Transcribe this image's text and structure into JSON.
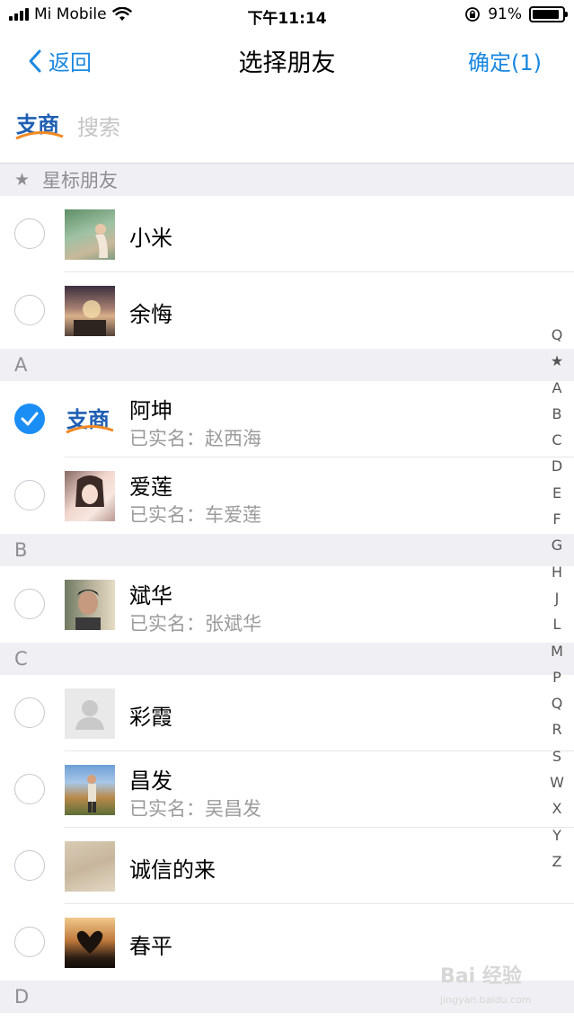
{
  "status_bar": {
    "carrier": "Mi Mobile",
    "time": "下午11:14",
    "battery_text": "91%",
    "battery_level": 0.91
  },
  "nav": {
    "back_label": "返回",
    "title": "选择朋友",
    "confirm_label": "确定(1)"
  },
  "search": {
    "placeholder": "搜索",
    "logo_text": "支商"
  },
  "sections": {
    "starred": {
      "label": "星标朋友",
      "items": [
        {
          "name": "小米"
        },
        {
          "name": "余悔"
        }
      ]
    },
    "a": {
      "label": "A",
      "items": [
        {
          "name": "阿坤",
          "realname": "已实名：赵西海"
        },
        {
          "name": "爱莲",
          "realname": "已实名：车爱莲"
        }
      ]
    },
    "b": {
      "label": "B",
      "items": [
        {
          "name": "斌华",
          "realname": "已实名：张斌华"
        }
      ]
    },
    "c": {
      "label": "C",
      "items": [
        {
          "name": "彩霞"
        },
        {
          "name": "昌发",
          "realname": "已实名：吴昌发"
        },
        {
          "name": "诚信的来"
        },
        {
          "name": "春平"
        }
      ]
    },
    "d": {
      "label": "D"
    }
  },
  "index": [
    "Q",
    "★",
    "A",
    "B",
    "C",
    "D",
    "E",
    "F",
    "G",
    "H",
    "J",
    "L",
    "M",
    "P",
    "Q",
    "R",
    "S",
    "W",
    "X",
    "Y",
    "Z"
  ],
  "watermark": {
    "text": "Bai 经验",
    "sub": "jingyan.baidu.com"
  },
  "colors": {
    "accent": "#1a88e0",
    "checked": "#1a8ef5",
    "section_bg": "#efeff4"
  }
}
